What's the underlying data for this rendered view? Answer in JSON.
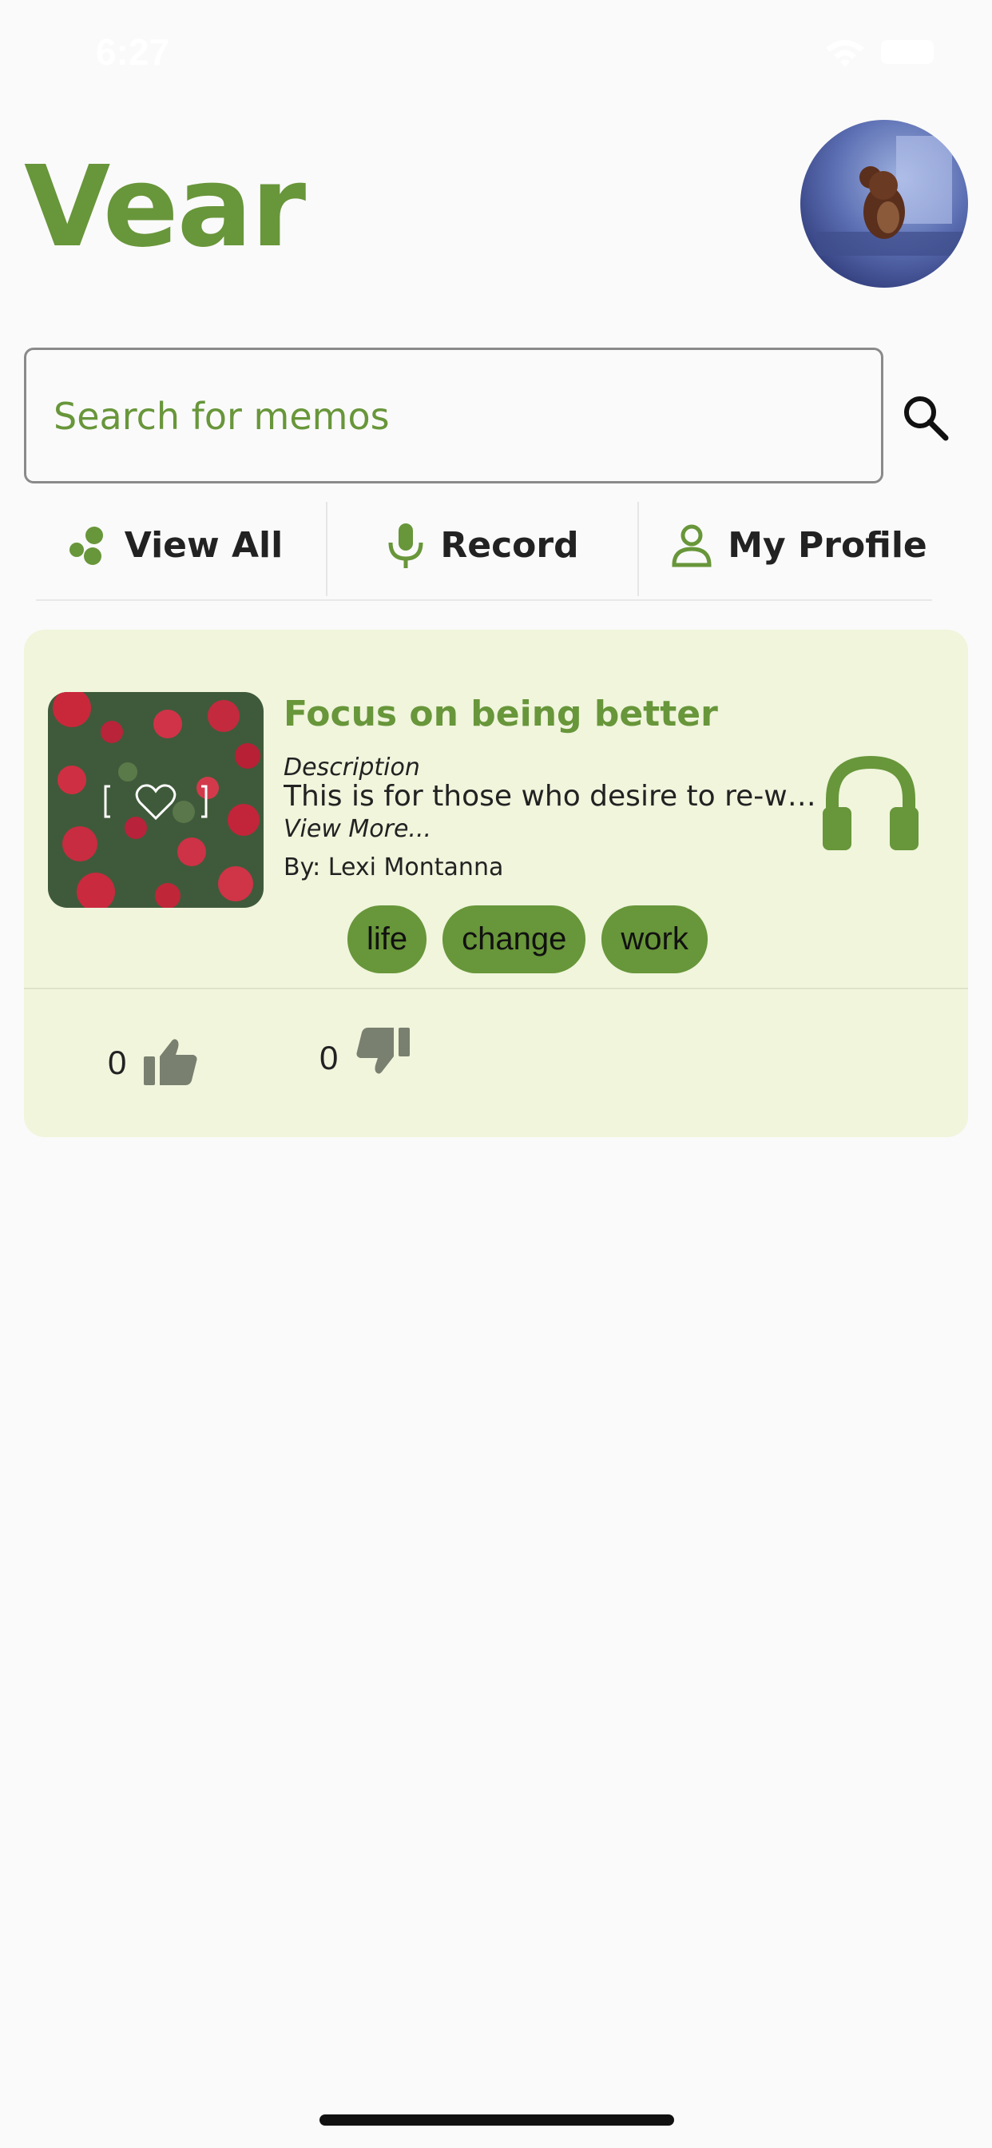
{
  "status_bar": {
    "time": "6:27"
  },
  "header": {
    "title": "Vear"
  },
  "search": {
    "placeholder": "Search for memos"
  },
  "tabs": [
    {
      "label": "View All",
      "icon": "dots-icon"
    },
    {
      "label": "Record",
      "icon": "microphone-icon"
    },
    {
      "label": "My Profile",
      "icon": "person-icon"
    }
  ],
  "memo": {
    "title": "Focus on being better",
    "description_label": "Description",
    "description": "This is for those who desire to re-write their story",
    "view_more": "View More...",
    "author": "By: Lexi Montanna",
    "tags": [
      "life",
      "change",
      "work"
    ],
    "likes": "0",
    "dislikes": "0"
  },
  "colors": {
    "accent": "#68963a",
    "card_bg": "#f0f5dc",
    "vote_icon": "#7a8070"
  }
}
